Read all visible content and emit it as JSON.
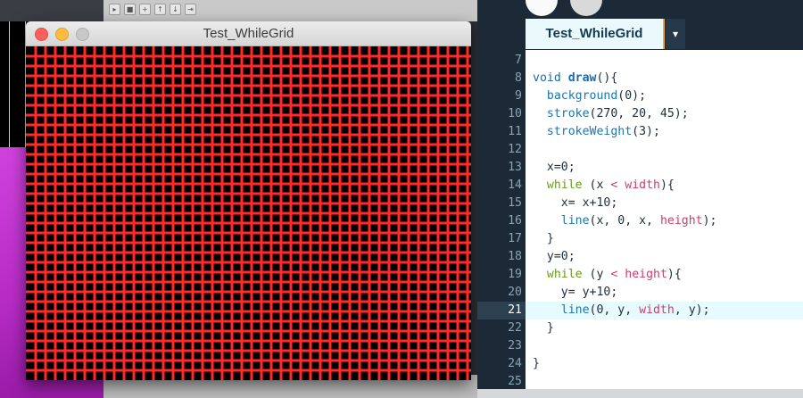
{
  "sketch_window": {
    "title": "Test_WhileGrid",
    "grid_spacing": 10,
    "background_color": "#000000",
    "stroke_color": "#ff2a2a",
    "stroke_weight": 3
  },
  "background_toolbar": {
    "icons": [
      "run-icon",
      "stop-icon",
      "new-icon",
      "open-icon",
      "save-icon",
      "export-icon"
    ]
  },
  "editor": {
    "tab_label": "Test_WhileGrid",
    "tab_menu_icon": "▾",
    "current_line": "21",
    "lines": [
      {
        "n": "7",
        "tokens": []
      },
      {
        "n": "8",
        "tokens": [
          {
            "t": "kw",
            "v": "void "
          },
          {
            "t": "fn",
            "v": "draw"
          },
          {
            "t": "op",
            "v": "(){"
          }
        ]
      },
      {
        "n": "9",
        "tokens": [
          {
            "t": "op",
            "v": "  "
          },
          {
            "t": "bi",
            "v": "background"
          },
          {
            "t": "op",
            "v": "(0);"
          }
        ]
      },
      {
        "n": "10",
        "tokens": [
          {
            "t": "op",
            "v": "  "
          },
          {
            "t": "bi",
            "v": "stroke"
          },
          {
            "t": "op",
            "v": "(270, 20, 45);"
          }
        ]
      },
      {
        "n": "11",
        "tokens": [
          {
            "t": "op",
            "v": "  "
          },
          {
            "t": "bi",
            "v": "strokeWeight"
          },
          {
            "t": "op",
            "v": "(3);"
          }
        ]
      },
      {
        "n": "12",
        "tokens": []
      },
      {
        "n": "13",
        "tokens": [
          {
            "t": "op",
            "v": "  x=0;"
          }
        ]
      },
      {
        "n": "14",
        "tokens": [
          {
            "t": "op",
            "v": "  "
          },
          {
            "t": "ctl",
            "v": "while"
          },
          {
            "t": "op",
            "v": " (x "
          },
          {
            "t": "var",
            "v": "<"
          },
          {
            "t": "op",
            "v": " "
          },
          {
            "t": "var",
            "v": "width"
          },
          {
            "t": "op",
            "v": "){"
          }
        ]
      },
      {
        "n": "15",
        "tokens": [
          {
            "t": "op",
            "v": "    x= x+10;"
          }
        ]
      },
      {
        "n": "16",
        "tokens": [
          {
            "t": "op",
            "v": "    "
          },
          {
            "t": "bi",
            "v": "line"
          },
          {
            "t": "op",
            "v": "(x, 0, x, "
          },
          {
            "t": "var",
            "v": "height"
          },
          {
            "t": "op",
            "v": ");"
          }
        ]
      },
      {
        "n": "17",
        "tokens": [
          {
            "t": "op",
            "v": "  }"
          }
        ]
      },
      {
        "n": "18",
        "tokens": [
          {
            "t": "op",
            "v": "  y=0;"
          }
        ]
      },
      {
        "n": "19",
        "tokens": [
          {
            "t": "op",
            "v": "  "
          },
          {
            "t": "ctl",
            "v": "while"
          },
          {
            "t": "op",
            "v": " (y "
          },
          {
            "t": "var",
            "v": "<"
          },
          {
            "t": "op",
            "v": " "
          },
          {
            "t": "var",
            "v": "height"
          },
          {
            "t": "op",
            "v": "){"
          }
        ]
      },
      {
        "n": "20",
        "tokens": [
          {
            "t": "op",
            "v": "    y= y+10;"
          }
        ]
      },
      {
        "n": "21",
        "tokens": [
          {
            "t": "op",
            "v": "    "
          },
          {
            "t": "bi",
            "v": "line"
          },
          {
            "t": "op",
            "v": "(0, y, "
          },
          {
            "t": "var",
            "v": "width"
          },
          {
            "t": "op",
            "v": ", y);"
          }
        ]
      },
      {
        "n": "22",
        "tokens": [
          {
            "t": "op",
            "v": "  }"
          }
        ]
      },
      {
        "n": "23",
        "tokens": []
      },
      {
        "n": "24",
        "tokens": [
          {
            "t": "op",
            "v": "}"
          }
        ]
      },
      {
        "n": "25",
        "tokens": []
      }
    ]
  }
}
